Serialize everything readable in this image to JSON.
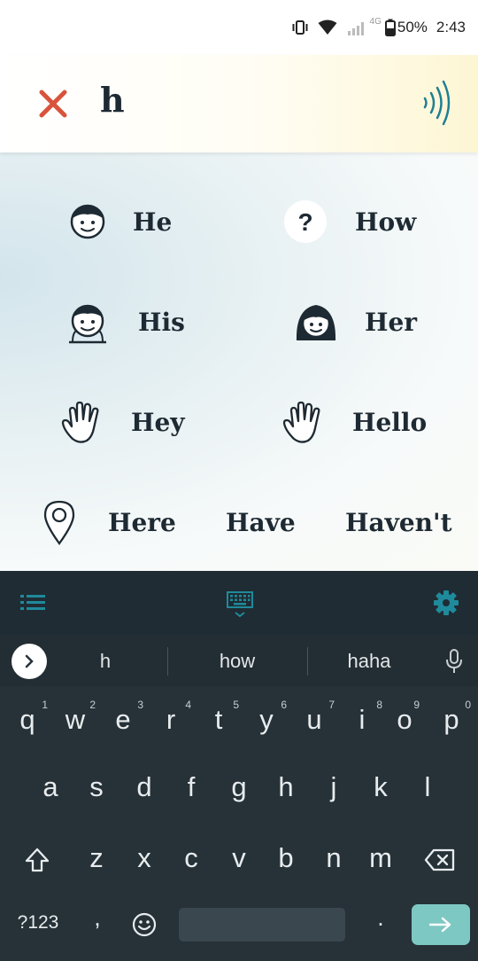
{
  "status_bar": {
    "network_label": "4G",
    "battery": "50%",
    "time": "2:43"
  },
  "input": {
    "text": "h"
  },
  "suggestions": [
    {
      "label": "He",
      "icon": "boy-face-icon"
    },
    {
      "label": "How",
      "icon": "question-icon"
    },
    {
      "label": "His",
      "icon": "boy-portrait-icon"
    },
    {
      "label": "Her",
      "icon": "girl-portrait-icon"
    },
    {
      "label": "Hey",
      "icon": "hand-wave-icon"
    },
    {
      "label": "Hello",
      "icon": "hand-wave-icon"
    },
    {
      "label": "Here",
      "icon": "location-pin-icon"
    },
    {
      "label": "Have",
      "icon": ""
    },
    {
      "label": "Haven't",
      "icon": ""
    }
  ],
  "keyboard": {
    "strip_words": [
      "h",
      "how",
      "haha"
    ],
    "row1": [
      {
        "key": "q",
        "hint": "1"
      },
      {
        "key": "w",
        "hint": "2"
      },
      {
        "key": "e",
        "hint": "3"
      },
      {
        "key": "r",
        "hint": "4"
      },
      {
        "key": "t",
        "hint": "5"
      },
      {
        "key": "y",
        "hint": "6"
      },
      {
        "key": "u",
        "hint": "7"
      },
      {
        "key": "i",
        "hint": "8"
      },
      {
        "key": "o",
        "hint": "9"
      },
      {
        "key": "p",
        "hint": "0"
      }
    ],
    "row2": [
      "a",
      "s",
      "d",
      "f",
      "g",
      "h",
      "j",
      "k",
      "l"
    ],
    "row3": [
      "z",
      "x",
      "c",
      "v",
      "b",
      "n",
      "m"
    ],
    "symbols_label": "?123",
    "comma": ",",
    "period": "."
  },
  "colors": {
    "clear_x": "#d9533c",
    "speak": "#1e7f94",
    "toolbar_accent": "#1f8a9c",
    "enter": "#7ec8c3",
    "keyboard_bg": "#263238"
  }
}
